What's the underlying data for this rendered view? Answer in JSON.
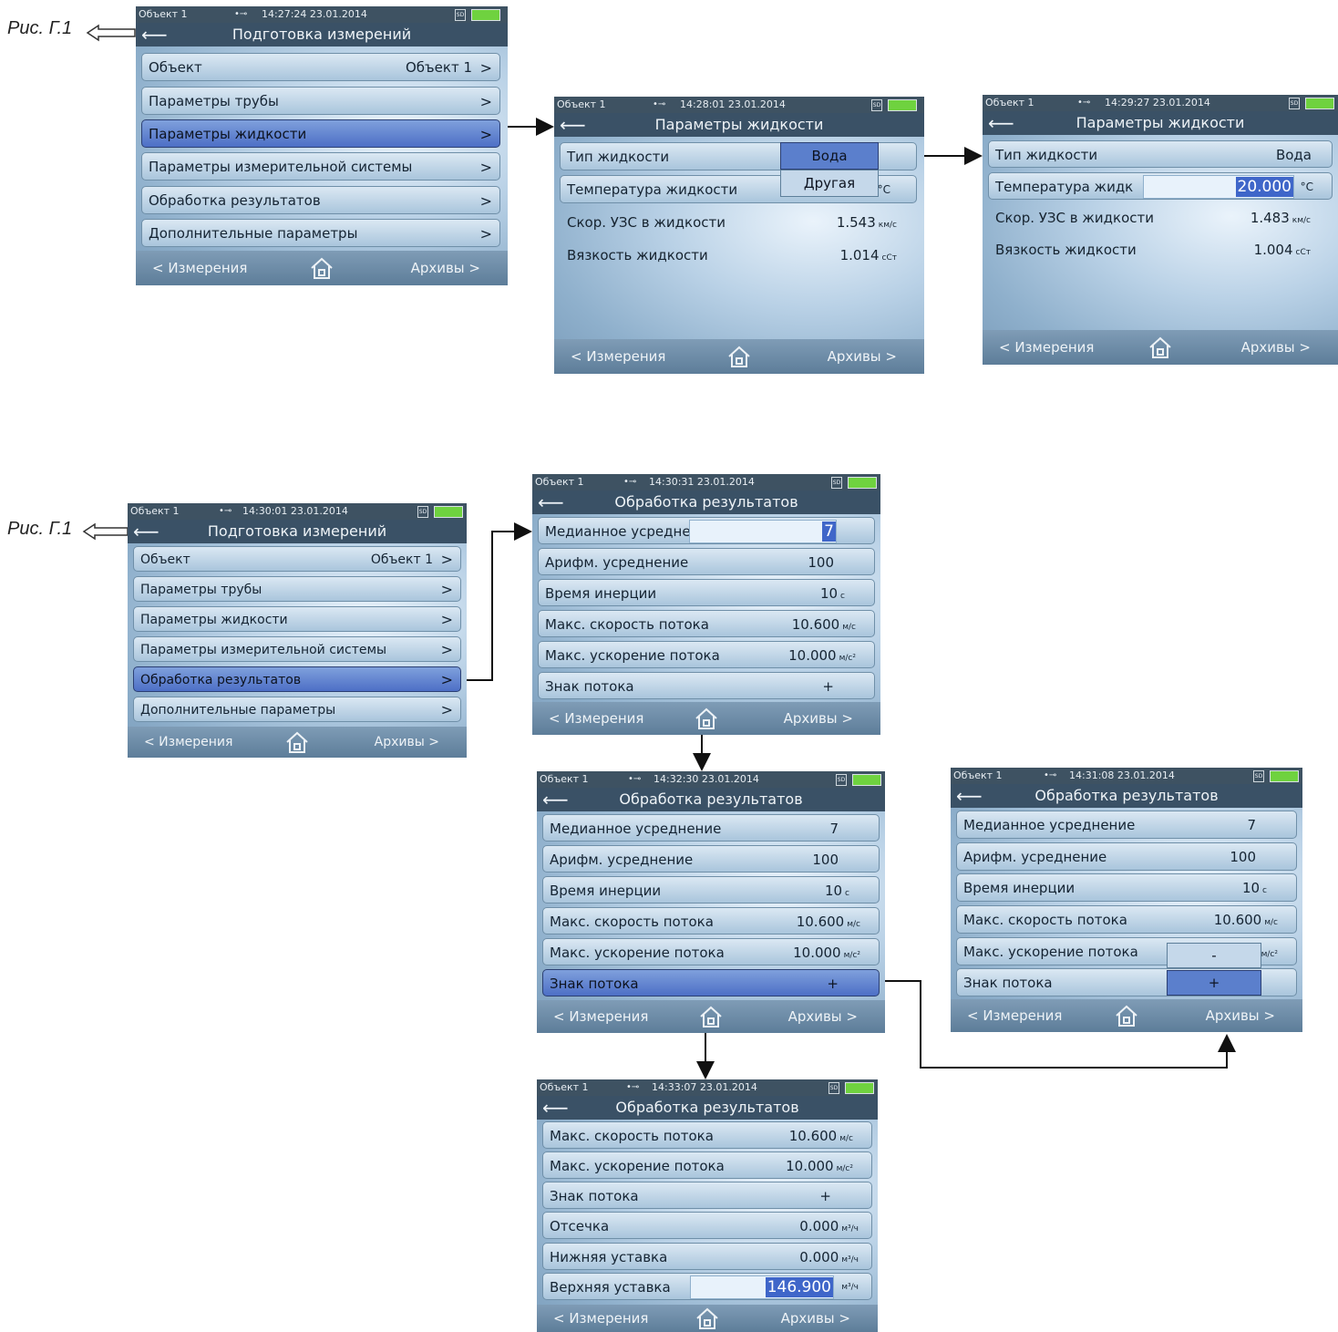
{
  "fig_label": "Рис. Г.1",
  "status": {
    "object": "Объект 1",
    "sd": "SD",
    "usb": "•⊸",
    "t1": "14:27:24  23.01.2014",
    "t2": "14:28:01  23.01.2014",
    "t3": "14:29:27  23.01.2014",
    "t4": "14:30:01  23.01.2014",
    "t5": "14:30:31  23.01.2014",
    "t6": "14:32:30  23.01.2014",
    "t7": "14:31:08  23.01.2014",
    "t8": "14:33:07  23.01.2014"
  },
  "titles": {
    "prep": "Подготовка измерений",
    "liquid": "Параметры жидкости",
    "proc": "Обработка результатов"
  },
  "footer": {
    "left": "< Измерения",
    "right": "Архивы >"
  },
  "menu": {
    "object": "Объект",
    "object_val": "Объект 1",
    "pipe": "Параметры трубы",
    "liquid": "Параметры жидкости",
    "meas_system": "Параметры измерительной системы",
    "processing": "Обработка результатов",
    "additional": "Дополнительные параметры",
    "chevron": ">"
  },
  "liquid": {
    "type": "Тип жидкости",
    "type_val": "Вода",
    "opt_water": "Вода",
    "opt_other": "Другая",
    "temp": "Температура жидкости",
    "temp_trunc": "Температура жидк",
    "temp_unit": "°C",
    "temp_edit": "20.000",
    "sound": "Скор. УЗС в жидкости",
    "sound_val_a": "1.543",
    "sound_val_b": "1.483",
    "sound_unit": "км/с",
    "visc": "Вязкость жидкости",
    "visc_val_a": "1.014",
    "visc_val_b": "1.004",
    "visc_unit": "сСт"
  },
  "proc": {
    "median": "Медианное усреднение",
    "median_trunc": "Медианное усредне",
    "median_val": "7",
    "arith": "Арифм. усреднение",
    "arith_val": "100",
    "inertia": "Время инерции",
    "inertia_val": "10",
    "inertia_unit": "с",
    "maxspeed": "Макс. скорость потока",
    "maxspeed_val": "10.600",
    "speed_unit": "м/с",
    "maxacc": "Макс. ускорение потока",
    "maxacc_val": "10.000",
    "acc_unit": "м/с²",
    "sign": "Знак потока",
    "sign_val": "+",
    "opt_minus": "-",
    "opt_plus": "+",
    "cutoff": "Отсечка",
    "cutoff_val": "0.000",
    "flow_unit": "м³/ч",
    "low": "Нижняя уставка",
    "low_val": "0.000",
    "high": "Верхняя уставка",
    "high_edit": "146.900"
  }
}
